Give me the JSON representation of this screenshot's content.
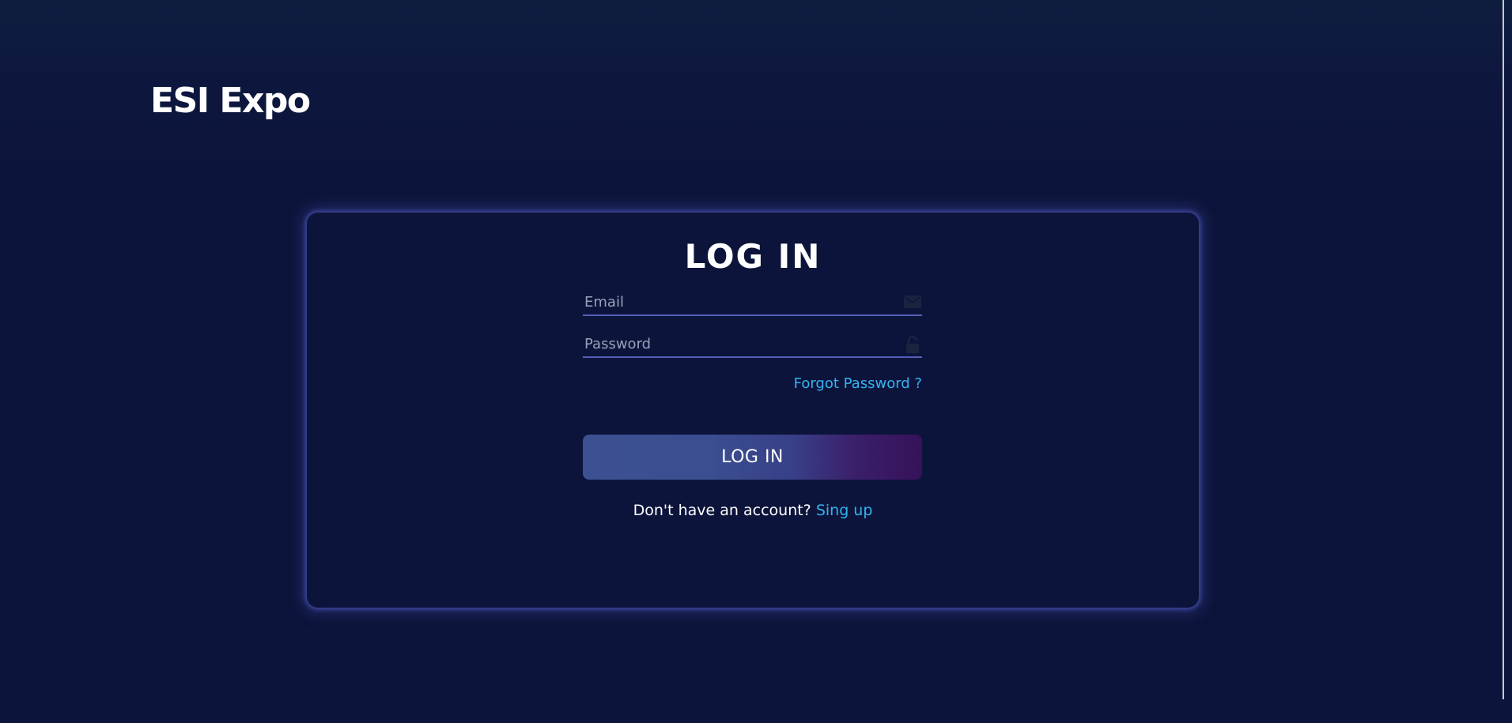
{
  "brand": {
    "name": "ESI Expo"
  },
  "login_card": {
    "title": "LOG IN",
    "email": {
      "placeholder": "Email",
      "value": "",
      "icon": "envelope-icon"
    },
    "password": {
      "placeholder": "Password",
      "value": "",
      "icon": "lock-icon"
    },
    "forgot_password_label": "Forgot Password ?",
    "submit_label": "LOG IN",
    "signup_prompt": "Don't have an account?",
    "signup_link_label": "Sing up"
  },
  "colors": {
    "background": "#0d143b",
    "accent_link": "#33b4f0",
    "field_underline": "#5560b8",
    "button_gradient_start": "#3c5191",
    "button_gradient_end": "#36125a"
  }
}
